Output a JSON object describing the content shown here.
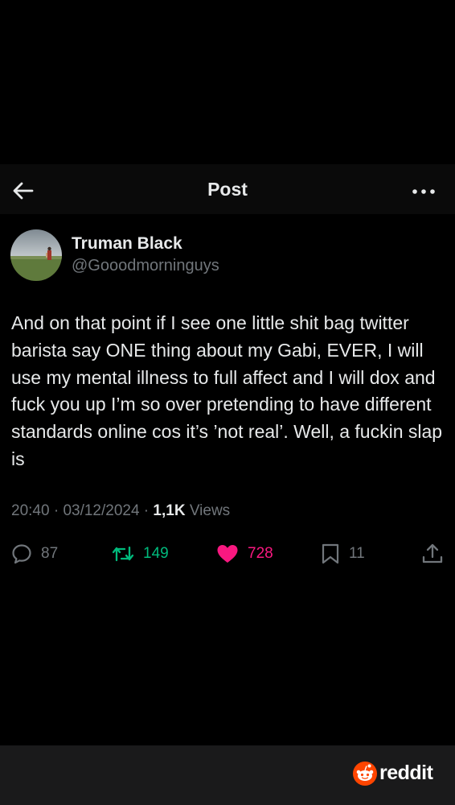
{
  "header": {
    "title": "Post",
    "back_icon": "arrow-left-icon",
    "more_icon": "more-horizontal-icon"
  },
  "author": {
    "name": "Truman Black",
    "handle": "@Gooodmorninguys"
  },
  "tweet": {
    "text": "And on that point if I see one little shit bag twitter barista say ONE thing about my Gabi, EVER, I will use my mental illness to full affect and I will dox and fuck you up I’m so over pretending to have different standards online cos it’s ’not real’. Well, a fuckin slap is"
  },
  "meta": {
    "time": "20:40",
    "separator": " · ",
    "date": "03/12/2024",
    "views_count": "1,1K",
    "views_label": " Views"
  },
  "actions": {
    "replies": "87",
    "retweets": "149",
    "likes": "728",
    "bookmarks": "11"
  },
  "colors": {
    "background": "#000000",
    "text": "#e7e9ea",
    "muted": "#71767b",
    "retweet": "#00ba7c",
    "like": "#f91880",
    "reddit_orange": "#ff4500"
  },
  "footer": {
    "brand": "reddit"
  }
}
